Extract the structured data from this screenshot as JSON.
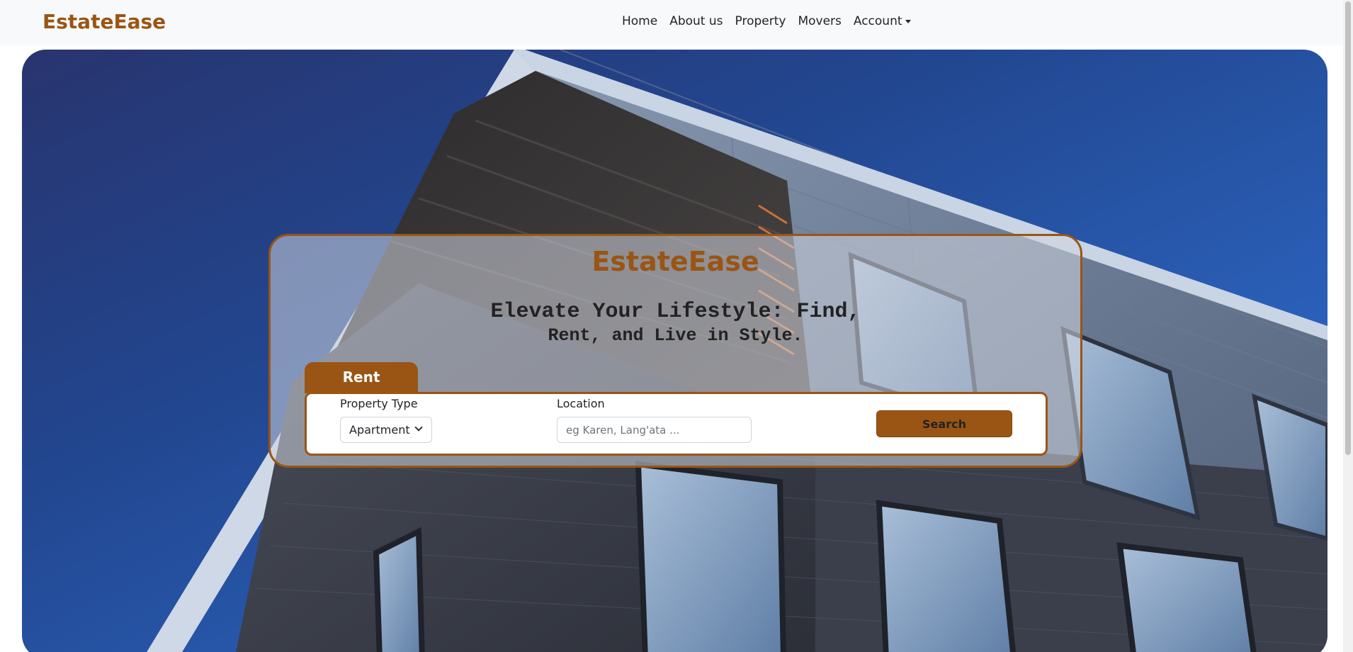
{
  "navbar": {
    "brand": "EstateEase",
    "links": [
      {
        "label": "Home"
      },
      {
        "label": "About us"
      },
      {
        "label": "Property"
      },
      {
        "label": "Movers"
      },
      {
        "label": "Account"
      }
    ]
  },
  "hero": {
    "title": "EstateEase",
    "tagline_line1": "Elevate Your Lifestyle: Find,",
    "tagline_line2": "Rent, and Live in Style.",
    "tab_label": "Rent",
    "search": {
      "property_type_label": "Property Type",
      "property_type_value": "Apartment",
      "location_label": "Location",
      "location_placeholder": "eg Karen, Lang'ata ...",
      "button_label": "Search"
    }
  },
  "colors": {
    "brand": "#9a5514",
    "navbar_bg": "#f8f9fa",
    "sky": "#2a5fb7"
  }
}
